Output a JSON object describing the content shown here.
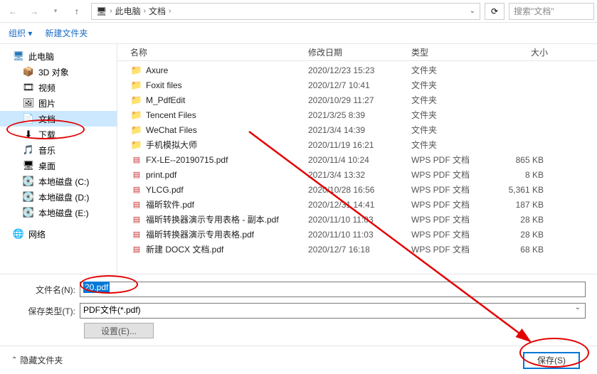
{
  "nav": {
    "path_root": "此电脑",
    "path_current": "文档"
  },
  "search": {
    "placeholder": "搜索\"文档\""
  },
  "toolbar": {
    "organize": "组织 ▾",
    "new_folder": "新建文件夹"
  },
  "sidebar": {
    "this_pc": "此电脑",
    "items": [
      {
        "label": "3D 对象",
        "icon": "📦"
      },
      {
        "label": "视频",
        "icon": "🎞"
      },
      {
        "label": "图片",
        "icon": "🖼"
      },
      {
        "label": "文档",
        "icon": "📄",
        "selected": true
      },
      {
        "label": "下载",
        "icon": "⬇"
      },
      {
        "label": "音乐",
        "icon": "🎵"
      },
      {
        "label": "桌面",
        "icon": "🖥"
      },
      {
        "label": "本地磁盘 (C:)",
        "icon": "💽"
      },
      {
        "label": "本地磁盘 (D:)",
        "icon": "💽"
      },
      {
        "label": "本地磁盘 (E:)",
        "icon": "💽"
      }
    ],
    "network": "网络"
  },
  "columns": {
    "name": "名称",
    "date": "修改日期",
    "type": "类型",
    "size": "大小"
  },
  "files": [
    {
      "name": "Axure",
      "date": "2020/12/23 15:23",
      "type": "文件夹",
      "size": "",
      "kind": "folder"
    },
    {
      "name": "Foxit files",
      "date": "2020/12/7 10:41",
      "type": "文件夹",
      "size": "",
      "kind": "folder"
    },
    {
      "name": "M_PdfEdit",
      "date": "2020/10/29 11:27",
      "type": "文件夹",
      "size": "",
      "kind": "folder"
    },
    {
      "name": "Tencent Files",
      "date": "2021/3/25 8:39",
      "type": "文件夹",
      "size": "",
      "kind": "folder"
    },
    {
      "name": "WeChat Files",
      "date": "2021/3/4 14:39",
      "type": "文件夹",
      "size": "",
      "kind": "folder"
    },
    {
      "name": "手机模拟大师",
      "date": "2020/11/19 16:21",
      "type": "文件夹",
      "size": "",
      "kind": "folder"
    },
    {
      "name": "FX-LE--20190715.pdf",
      "date": "2020/11/4 10:24",
      "type": "WPS PDF 文档",
      "size": "865 KB",
      "kind": "pdf"
    },
    {
      "name": "print.pdf",
      "date": "2021/3/4 13:32",
      "type": "WPS PDF 文档",
      "size": "8 KB",
      "kind": "pdf"
    },
    {
      "name": "YLCG.pdf",
      "date": "2020/10/28 16:56",
      "type": "WPS PDF 文档",
      "size": "5,361 KB",
      "kind": "pdf"
    },
    {
      "name": "福昕软件.pdf",
      "date": "2020/12/31 14:41",
      "type": "WPS PDF 文档",
      "size": "187 KB",
      "kind": "pdf"
    },
    {
      "name": "福昕转换器演示专用表格 - 副本.pdf",
      "date": "2020/11/10 11:03",
      "type": "WPS PDF 文档",
      "size": "28 KB",
      "kind": "pdf"
    },
    {
      "name": "福昕转换器演示专用表格.pdf",
      "date": "2020/11/10 11:03",
      "type": "WPS PDF 文档",
      "size": "28 KB",
      "kind": "pdf"
    },
    {
      "name": "新建 DOCX 文档.pdf",
      "date": "2020/12/7 16:18",
      "type": "WPS PDF 文档",
      "size": "68 KB",
      "kind": "pdf"
    }
  ],
  "bottom": {
    "filename_label": "文件名(N):",
    "filename_value": "20.pdf",
    "filetype_label": "保存类型(T):",
    "filetype_value": "PDF文件(*.pdf)",
    "settings_btn": "设置(E)..."
  },
  "footer": {
    "hide_folders": "隐藏文件夹",
    "save_btn": "保存(S)"
  }
}
